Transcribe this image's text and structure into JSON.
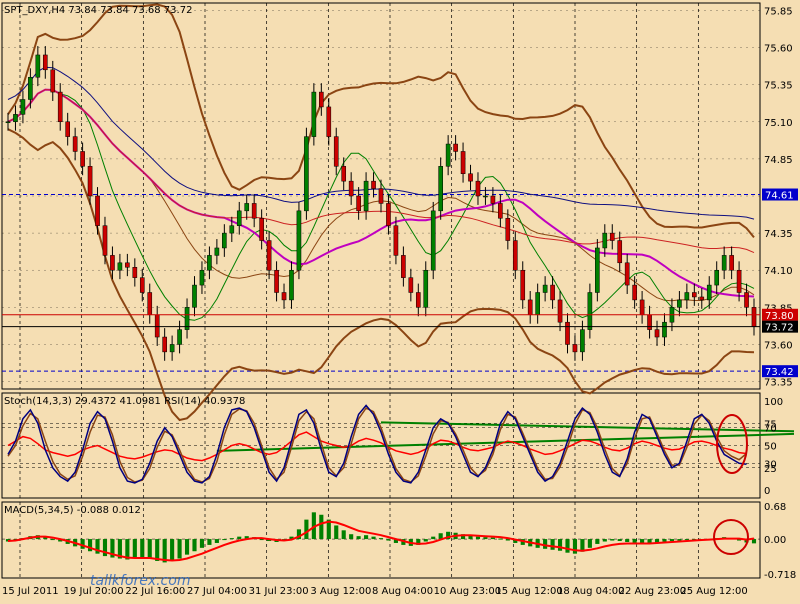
{
  "chart_data": {
    "type": "line",
    "colors": {
      "background": "#f5deb3",
      "grid": "#000000",
      "candle_up": "#008000",
      "candle_down": "#cc0000",
      "bollinger": "#8b4513",
      "ma_magenta": "#c000c0",
      "ma_navy": "#101080",
      "ma_red": "#cc2222",
      "level_blue": "#0000cc",
      "rsi": "#ff0000",
      "stoch_main": "#000080",
      "stoch_signal": "#8b4513",
      "trendline": "#008000",
      "macd_hist": "#008000",
      "macd_signal": "#ff0000",
      "annotation": "#cc0000"
    },
    "main": {
      "title": "SPT_DXY,H4  73.84 73.84 73.68 73.72",
      "y_range": [
        73.3,
        75.9
      ],
      "price_ticks": [
        "75.85",
        "75.60",
        "75.35",
        "75.10",
        "74.85",
        "74.60",
        "74.35",
        "74.10",
        "73.85",
        "73.60",
        "73.35"
      ],
      "current_price": 73.72,
      "current_tag": "73.72",
      "red_level": 73.8,
      "red_tag": "73.80",
      "blue_levels": [
        74.61,
        73.42
      ],
      "blue_tags": [
        "74.61",
        "73.42"
      ],
      "close_series": [
        75.1,
        75.15,
        75.25,
        75.4,
        75.55,
        75.45,
        75.3,
        75.1,
        75.0,
        74.9,
        74.8,
        74.6,
        74.4,
        74.2,
        74.1,
        74.15,
        74.12,
        74.05,
        73.95,
        73.8,
        73.65,
        73.55,
        73.6,
        73.7,
        73.85,
        74.0,
        74.1,
        74.2,
        74.25,
        74.35,
        74.4,
        74.5,
        74.55,
        74.45,
        74.3,
        74.1,
        73.95,
        73.9,
        74.1,
        74.5,
        75.0,
        75.3,
        75.2,
        75.0,
        74.8,
        74.7,
        74.6,
        74.5,
        74.7,
        74.65,
        74.55,
        74.4,
        74.2,
        74.05,
        73.95,
        73.85,
        74.1,
        74.5,
        74.8,
        74.95,
        74.9,
        74.75,
        74.7,
        74.6,
        74.6,
        74.55,
        74.45,
        74.3,
        74.1,
        73.9,
        73.8,
        73.95,
        74.0,
        73.9,
        73.75,
        73.6,
        73.55,
        73.7,
        73.95,
        74.25,
        74.35,
        74.3,
        74.15,
        74.0,
        73.9,
        73.8,
        73.7,
        73.65,
        73.75,
        73.85,
        73.9,
        73.95,
        73.92,
        73.9,
        74.0,
        74.1,
        74.2,
        74.1,
        73.95,
        73.85,
        73.72
      ]
    },
    "stoch": {
      "title": "Stoch(14,3,3) 29.4372 41.0981  RSI(14) 40.9378",
      "scale_labels": [
        "100",
        "75",
        "70",
        "50",
        "30",
        "25",
        "0"
      ],
      "scale_values": [
        100,
        75,
        70,
        50,
        30,
        25,
        0
      ],
      "main": [
        40,
        55,
        80,
        90,
        75,
        45,
        25,
        15,
        10,
        20,
        45,
        75,
        88,
        80,
        55,
        25,
        10,
        8,
        12,
        30,
        55,
        70,
        60,
        40,
        20,
        10,
        8,
        15,
        40,
        70,
        90,
        92,
        88,
        70,
        45,
        20,
        10,
        25,
        55,
        85,
        90,
        75,
        45,
        20,
        15,
        30,
        60,
        85,
        95,
        85,
        65,
        40,
        20,
        10,
        8,
        20,
        45,
        70,
        80,
        75,
        60,
        40,
        20,
        15,
        25,
        45,
        75,
        88,
        80,
        60,
        40,
        20,
        10,
        15,
        30,
        55,
        80,
        92,
        85,
        65,
        40,
        20,
        15,
        35,
        65,
        85,
        80,
        60,
        40,
        25,
        30,
        55,
        80,
        85,
        75,
        55,
        40,
        35,
        30,
        29
      ],
      "signal": [
        38,
        50,
        72,
        86,
        80,
        55,
        32,
        18,
        12,
        16,
        38,
        65,
        84,
        82,
        62,
        32,
        14,
        9,
        11,
        24,
        48,
        66,
        62,
        45,
        25,
        12,
        9,
        13,
        32,
        62,
        85,
        91,
        89,
        75,
        50,
        25,
        12,
        20,
        48,
        78,
        88,
        80,
        52,
        25,
        16,
        25,
        52,
        80,
        92,
        88,
        70,
        46,
        24,
        12,
        9,
        16,
        38,
        63,
        78,
        76,
        63,
        45,
        25,
        16,
        22,
        40,
        68,
        85,
        82,
        64,
        44,
        24,
        12,
        13,
        26,
        48,
        74,
        90,
        87,
        70,
        46,
        24,
        16,
        30,
        58,
        80,
        82,
        64,
        44,
        28,
        28,
        48,
        74,
        84,
        78,
        60,
        44,
        38,
        34,
        41
      ],
      "rsi": [
        50,
        55,
        60,
        58,
        52,
        45,
        42,
        40,
        38,
        40,
        45,
        48,
        50,
        46,
        42,
        38,
        36,
        35,
        37,
        40,
        43,
        45,
        44,
        40,
        36,
        34,
        33,
        36,
        40,
        45,
        50,
        52,
        50,
        46,
        42,
        40,
        42,
        48,
        55,
        62,
        65,
        60,
        55,
        52,
        50,
        48,
        50,
        55,
        58,
        56,
        53,
        48,
        44,
        42,
        40,
        42,
        46,
        52,
        56,
        55,
        52,
        48,
        45,
        44,
        46,
        48,
        52,
        55,
        53,
        50,
        46,
        43,
        40,
        41,
        44,
        48,
        52,
        56,
        55,
        52,
        48,
        45,
        44,
        47,
        52,
        55,
        53,
        50,
        47,
        45,
        46,
        50,
        54,
        55,
        53,
        50,
        47,
        45,
        42,
        41
      ],
      "trend_upper": [
        76,
        66
      ],
      "trend_lower": [
        44,
        63
      ]
    },
    "macd": {
      "title": "MACD(5,34,5) -0.088 0.012",
      "scale_labels": [
        "0.68",
        "0.00",
        "-0.718"
      ],
      "scale_values": [
        0.68,
        0.0,
        -0.718
      ],
      "hist": [
        -0.05,
        -0.02,
        0.02,
        0.06,
        0.08,
        0.05,
        0.0,
        -0.05,
        -0.1,
        -0.15,
        -0.2,
        -0.25,
        -0.3,
        -0.35,
        -0.38,
        -0.4,
        -0.42,
        -0.4,
        -0.38,
        -0.4,
        -0.45,
        -0.48,
        -0.45,
        -0.4,
        -0.32,
        -0.25,
        -0.18,
        -0.12,
        -0.08,
        -0.02,
        0.02,
        0.05,
        0.06,
        0.04,
        0.0,
        -0.04,
        -0.06,
        -0.04,
        0.05,
        0.2,
        0.4,
        0.55,
        0.5,
        0.4,
        0.28,
        0.18,
        0.1,
        0.06,
        0.08,
        0.05,
        0.02,
        -0.03,
        -0.08,
        -0.12,
        -0.14,
        -0.12,
        -0.05,
        0.05,
        0.12,
        0.15,
        0.13,
        0.1,
        0.08,
        0.05,
        0.04,
        0.03,
        0.01,
        -0.03,
        -0.08,
        -0.12,
        -0.15,
        -0.18,
        -0.2,
        -0.22,
        -0.24,
        -0.28,
        -0.3,
        -0.26,
        -0.18,
        -0.1,
        -0.05,
        -0.03,
        -0.04,
        -0.06,
        -0.07,
        -0.08,
        -0.08,
        -0.07,
        -0.05,
        -0.04,
        -0.03,
        -0.02,
        -0.02,
        -0.01,
        0.0,
        0.02,
        0.04,
        0.02,
        -0.03,
        -0.07,
        -0.088
      ],
      "signal": [
        -0.04,
        -0.03,
        0.0,
        0.03,
        0.05,
        0.05,
        0.03,
        0.0,
        -0.04,
        -0.08,
        -0.13,
        -0.18,
        -0.23,
        -0.27,
        -0.31,
        -0.35,
        -0.38,
        -0.39,
        -0.39,
        -0.39,
        -0.41,
        -0.43,
        -0.44,
        -0.43,
        -0.4,
        -0.35,
        -0.3,
        -0.24,
        -0.18,
        -0.12,
        -0.07,
        -0.03,
        0.0,
        0.02,
        0.02,
        0.0,
        -0.02,
        -0.03,
        -0.01,
        0.05,
        0.14,
        0.25,
        0.32,
        0.36,
        0.34,
        0.29,
        0.23,
        0.17,
        0.14,
        0.11,
        0.08,
        0.04,
        0.0,
        -0.04,
        -0.08,
        -0.1,
        -0.09,
        -0.06,
        -0.01,
        0.04,
        0.07,
        0.08,
        0.08,
        0.07,
        0.06,
        0.05,
        0.04,
        0.02,
        -0.01,
        -0.04,
        -0.07,
        -0.1,
        -0.13,
        -0.15,
        -0.17,
        -0.2,
        -0.23,
        -0.24,
        -0.22,
        -0.19,
        -0.15,
        -0.12,
        -0.1,
        -0.09,
        -0.09,
        -0.09,
        -0.09,
        -0.08,
        -0.07,
        -0.06,
        -0.05,
        -0.04,
        -0.03,
        -0.02,
        -0.01,
        0.0,
        0.01,
        0.01,
        0.01,
        -0.01,
        0.012
      ]
    },
    "x_labels": [
      "15 Jul 2011",
      "19 Jul 20:00",
      "22 Jul 16:00",
      "27 Jul 04:00",
      "31 Jul 23:00",
      "3 Aug 12:00",
      "8 Aug 04:00",
      "10 Aug 23:00",
      "15 Aug 12:00",
      "18 Aug 04:00",
      "22 Aug 23:00",
      "25 Aug 12:00"
    ],
    "watermark": "tallkforex.com"
  }
}
